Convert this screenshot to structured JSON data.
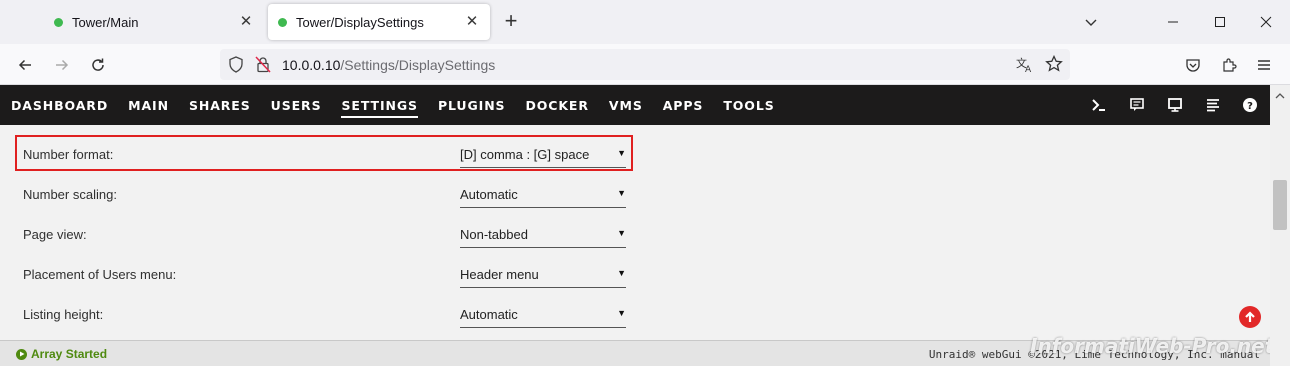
{
  "browser": {
    "tabs": [
      {
        "title": "Tower/Main",
        "active": false
      },
      {
        "title": "Tower/DisplaySettings",
        "active": true
      }
    ],
    "url_host": "10.0.0.10",
    "url_path": "/Settings/DisplaySettings"
  },
  "menu": {
    "items": [
      "DASHBOARD",
      "MAIN",
      "SHARES",
      "USERS",
      "SETTINGS",
      "PLUGINS",
      "DOCKER",
      "VMS",
      "APPS",
      "TOOLS"
    ],
    "active": "SETTINGS"
  },
  "settings": [
    {
      "label": "Number format:",
      "value": "[D] comma : [G] space",
      "highlighted": true
    },
    {
      "label": "Number scaling:",
      "value": "Automatic"
    },
    {
      "label": "Page view:",
      "value": "Non-tabbed"
    },
    {
      "label": "Placement of Users menu:",
      "value": "Header menu"
    },
    {
      "label": "Listing height:",
      "value": "Automatic"
    }
  ],
  "footer": {
    "array_status": "Array Started",
    "copyright": "Unraid® webGui ©2021, Lime Technology, Inc. manual"
  },
  "watermark": "InformatiWeb-Pro.net",
  "colors": {
    "header_bg": "#1c1b1b",
    "highlight_border": "#e02020",
    "status_green": "#4f8a10",
    "scroll_top_red": "#e22828"
  }
}
